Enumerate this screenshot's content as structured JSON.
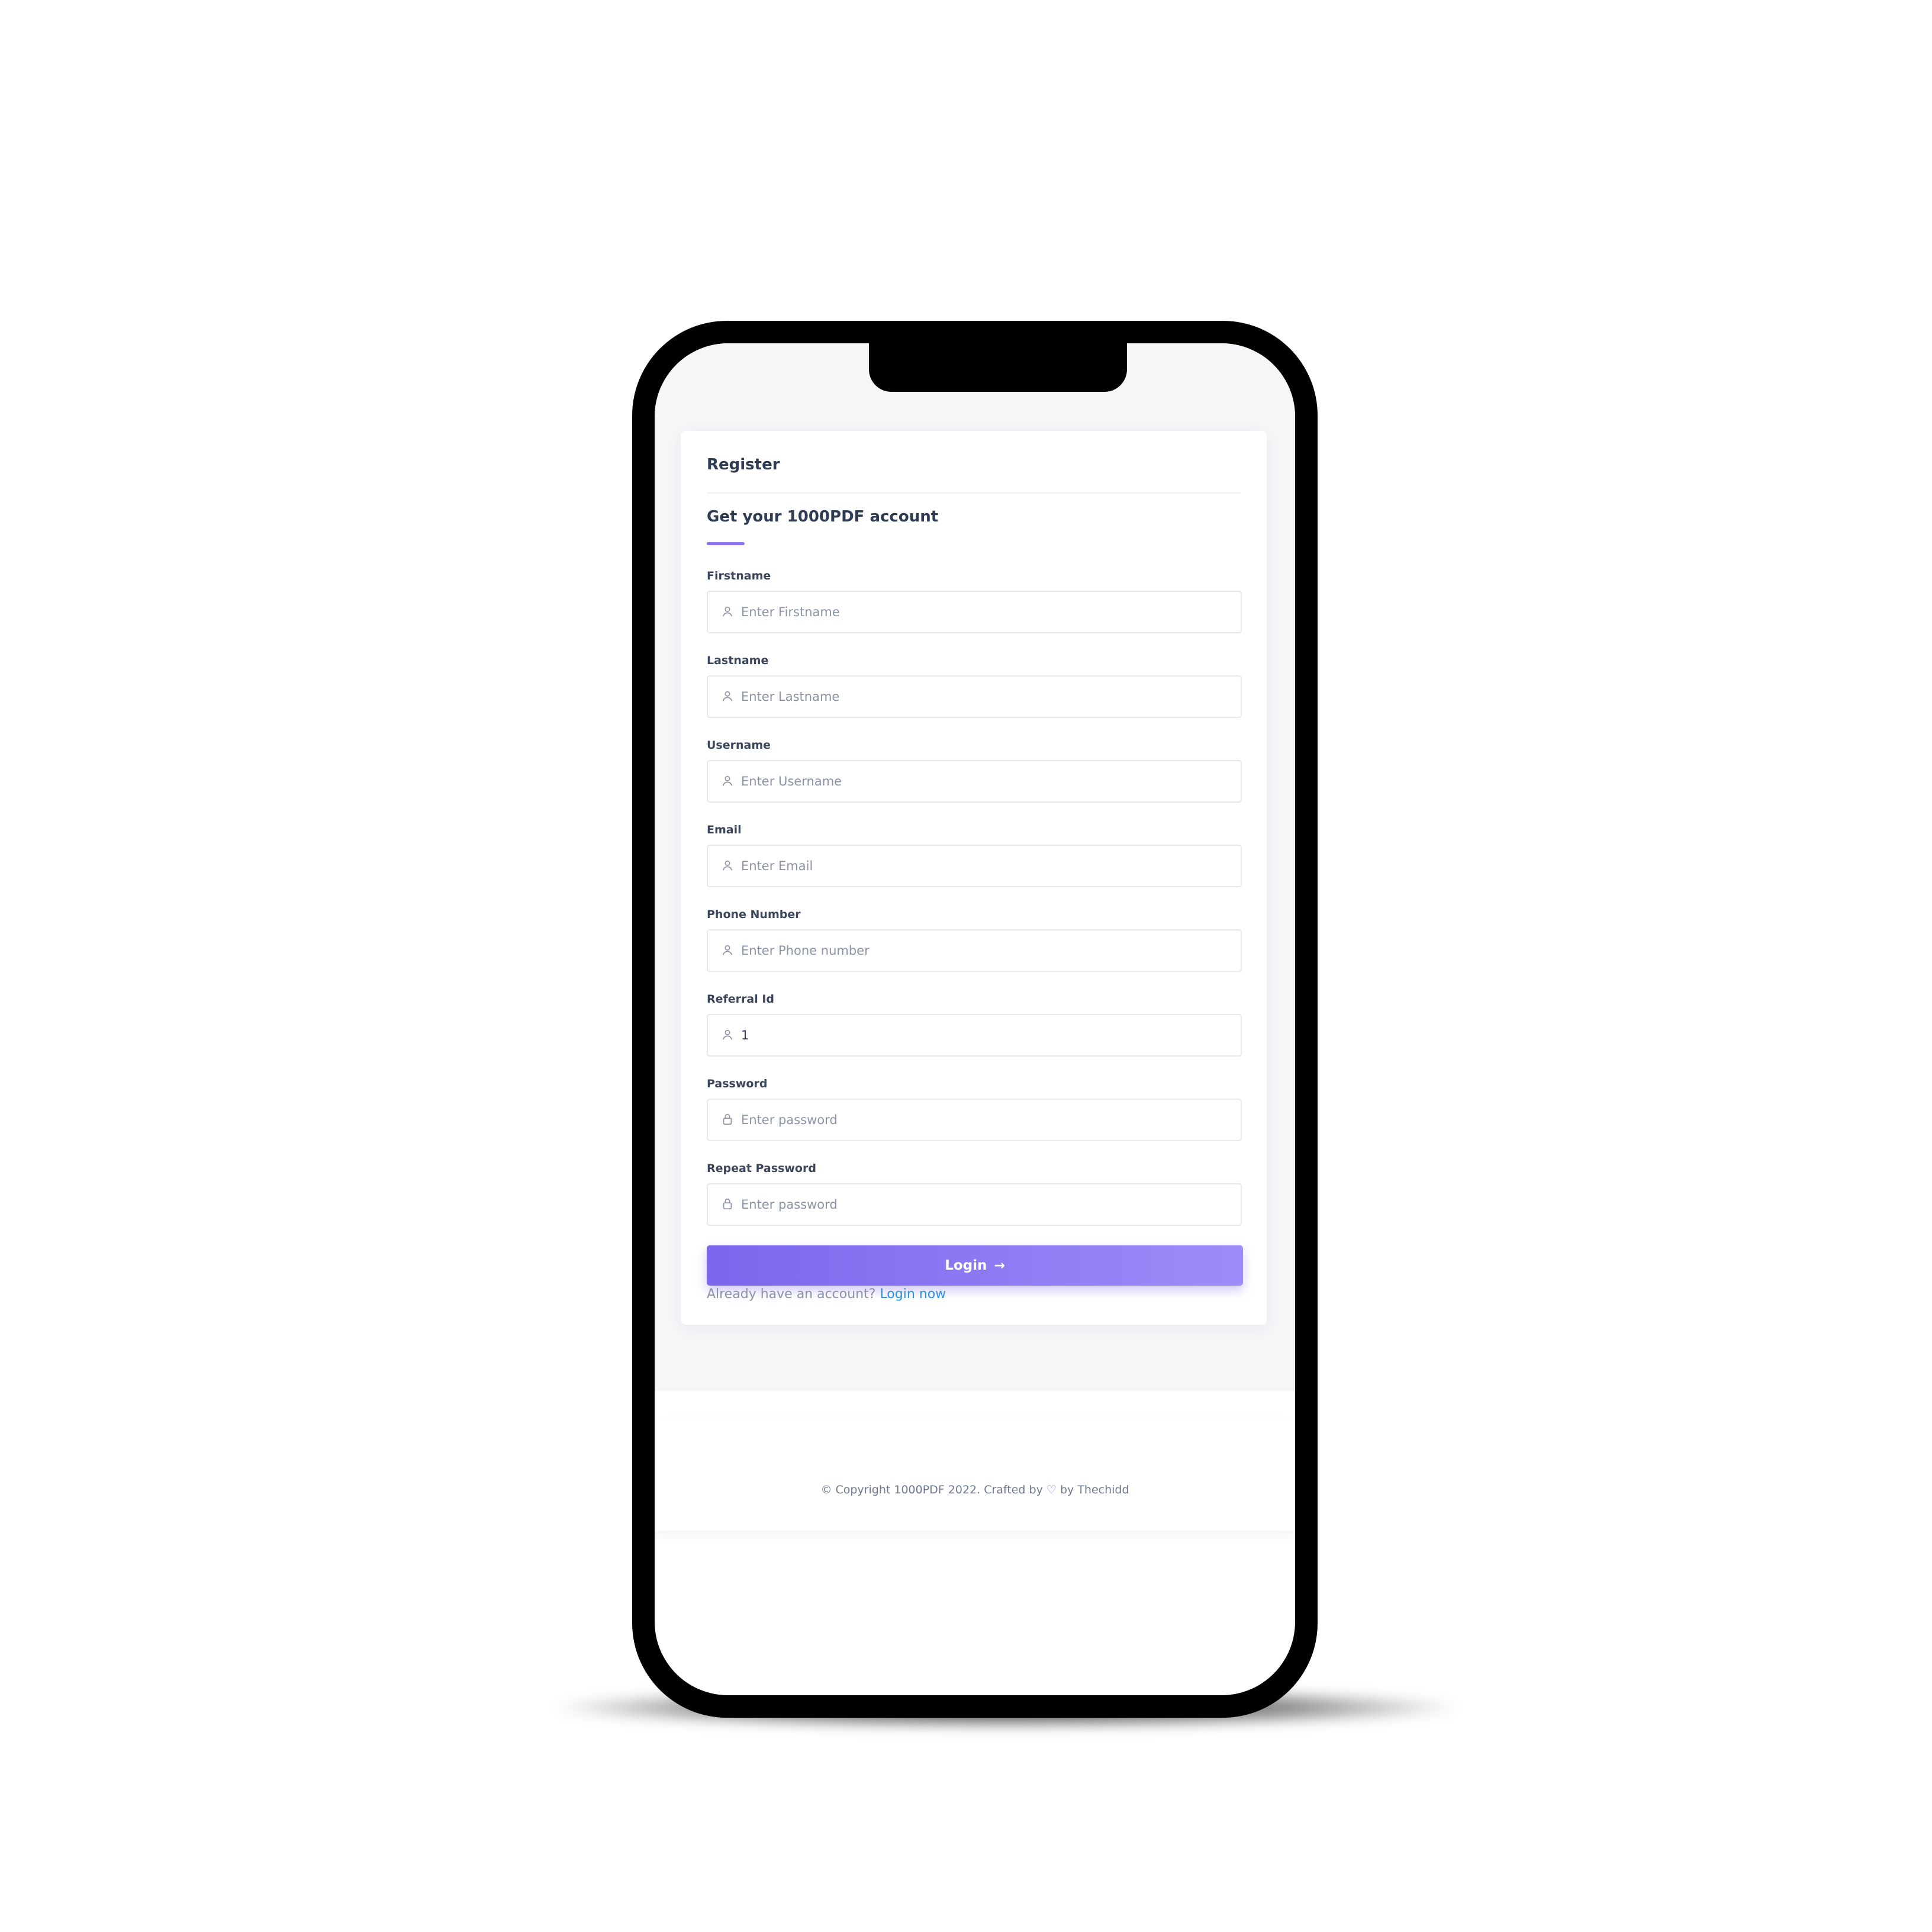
{
  "card": {
    "title": "Register",
    "subtitle": "Get your 1000PDF account"
  },
  "fields": [
    {
      "label": "Firstname",
      "placeholder": "Enter Firstname",
      "value": "",
      "icon": "user-icon"
    },
    {
      "label": "Lastname",
      "placeholder": "Enter Lastname",
      "value": "",
      "icon": "user-icon"
    },
    {
      "label": "Username",
      "placeholder": "Enter Username",
      "value": "",
      "icon": "user-icon"
    },
    {
      "label": "Email",
      "placeholder": "Enter Email",
      "value": "",
      "icon": "user-icon"
    },
    {
      "label": "Phone Number",
      "placeholder": "Enter Phone number",
      "value": "",
      "icon": "user-icon"
    },
    {
      "label": "Referral Id",
      "placeholder": "",
      "value": "1",
      "icon": "user-icon"
    },
    {
      "label": "Password",
      "placeholder": "Enter password",
      "value": "",
      "icon": "lock-icon"
    },
    {
      "label": "Repeat Password",
      "placeholder": "Enter password",
      "value": "",
      "icon": "lock-icon"
    }
  ],
  "submit": {
    "label": "Login",
    "icon": "arrow-right-icon"
  },
  "signin": {
    "prompt": "Already have an account?",
    "link": "Login now"
  },
  "footer": {
    "prefix": "© Copyright 1000PDF 2022. Crafted by",
    "heart": "♡",
    "suffix": "by Thechidd"
  },
  "colors": {
    "accent": "#8b73f3",
    "button_start": "#7b66ec",
    "button_end": "#9d8cf9",
    "link": "#2b8fdd",
    "heading": "#2f3a53",
    "muted": "#8a92a6"
  }
}
